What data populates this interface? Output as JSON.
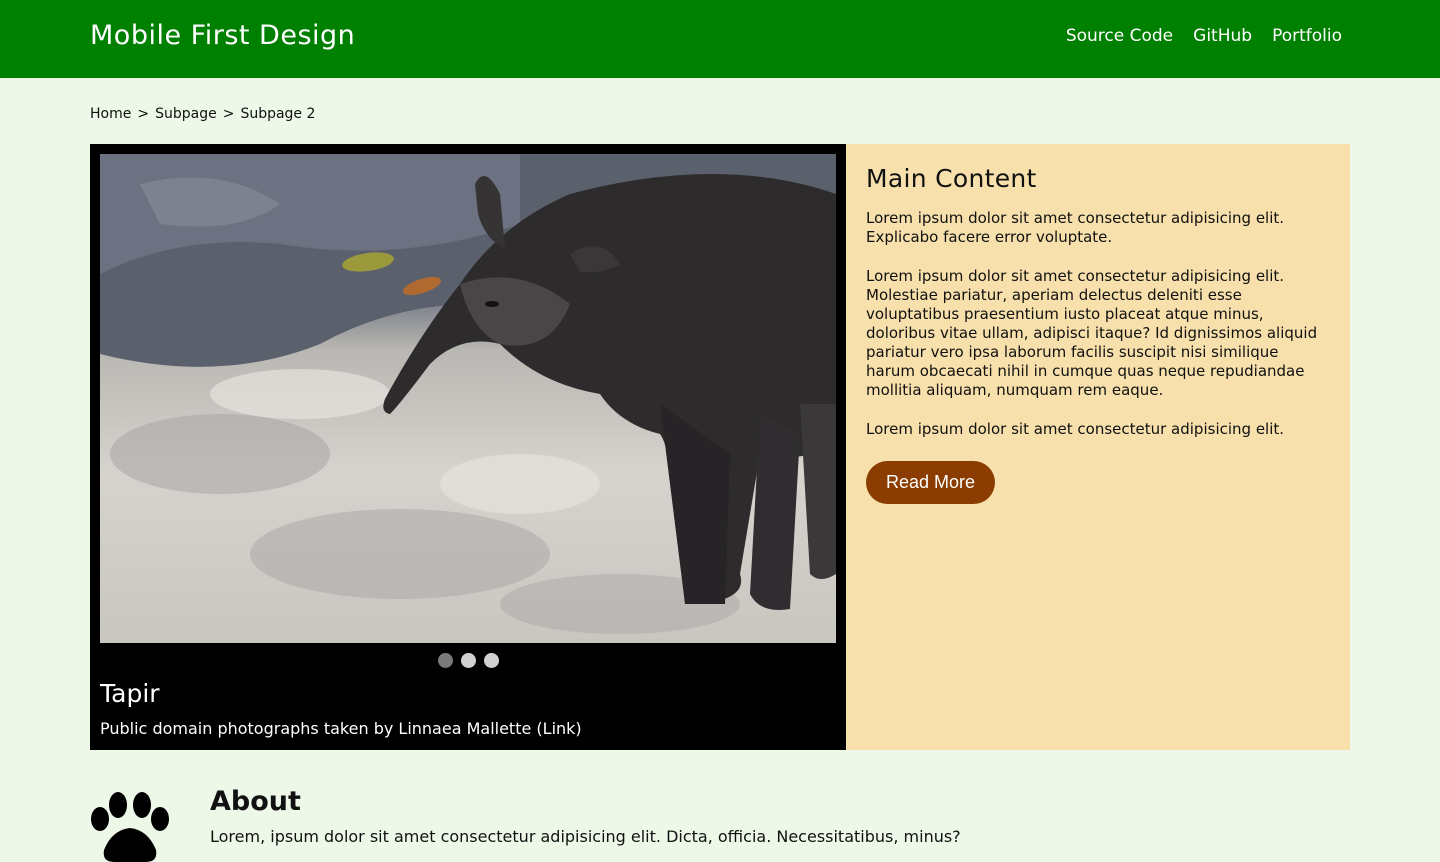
{
  "header": {
    "title": "Mobile First Design",
    "nav": [
      "Source Code",
      "GitHub",
      "Portfolio"
    ]
  },
  "breadcrumb": {
    "items": [
      "Home",
      "Subpage",
      "Subpage 2"
    ],
    "separator": ">"
  },
  "slider": {
    "image_subject": "tapir",
    "caption_title": "Tapir",
    "caption_text": "Public domain photographs taken by Linnaea Mallette",
    "caption_link": "(Link)",
    "slide_count": 3,
    "active_slide": 1
  },
  "main": {
    "heading": "Main Content",
    "paragraphs": [
      "Lorem ipsum dolor sit amet consectetur adipisicing elit. Explicabo facere error voluptate.",
      "Lorem ipsum dolor sit amet consectetur adipisicing elit. Molestiae pariatur, aperiam delectus deleniti esse voluptatibus praesentium iusto placeat atque minus, doloribus vitae ullam, adipisci itaque? Id dignissimos aliquid pariatur vero ipsa laborum facilis suscipit nisi similique harum obcaecati nihil in cumque quas neque repudiandae mollitia aliquam, numquam rem eaque.",
      "Lorem ipsum dolor sit amet consectetur adipisicing elit."
    ],
    "button_label": "Read More"
  },
  "about": {
    "icon": "paw-icon",
    "title": "About",
    "text": "Lorem, ipsum dolor sit amet consectetur adipisicing elit. Dicta, officia. Necessitatibus, minus?"
  },
  "colors": {
    "header_bg": "#008000",
    "page_bg": "#eef8e8",
    "main_bg": "#f7e0ab",
    "button_bg": "#8b3c00",
    "slider_bg": "#000000"
  }
}
